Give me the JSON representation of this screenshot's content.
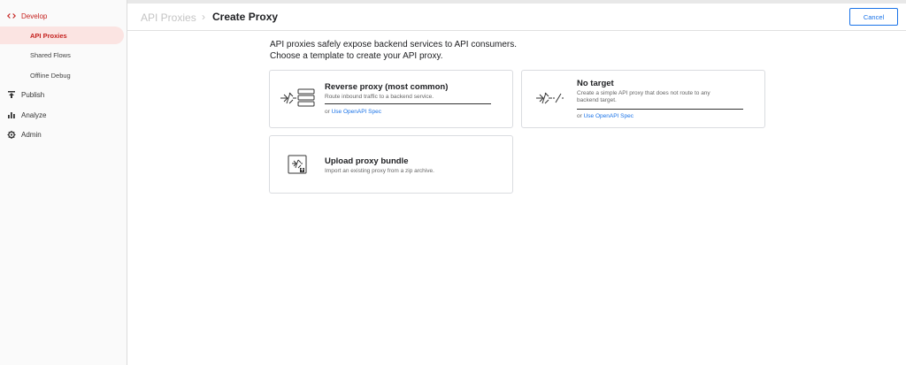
{
  "sidebar": {
    "develop": "Develop",
    "items": [
      "API Proxies",
      "Shared Flows",
      "Offline Debug"
    ],
    "publish": "Publish",
    "analyze": "Analyze",
    "admin": "Admin"
  },
  "header": {
    "crumb_parent": "API Proxies",
    "crumb_sep": "›",
    "title": "Create Proxy",
    "cancel": "Cancel"
  },
  "intro": {
    "line1": "API proxies safely expose backend services to API consumers.",
    "line2": "Choose a template to create your API proxy."
  },
  "cards": {
    "reverse": {
      "title": "Reverse proxy (most common)",
      "desc": "Route inbound traffic to a backend service.",
      "spec_prefix": "or ",
      "spec_link": "Use OpenAPI Spec"
    },
    "notarget": {
      "title": "No target",
      "desc1": "Create a simple API proxy that does not route to any",
      "desc2": "backend target.",
      "spec_prefix": "or ",
      "spec_link": "Use OpenAPI Spec"
    },
    "upload": {
      "title": "Upload proxy bundle",
      "desc": "Import an existing proxy from a zip archive."
    }
  },
  "colors": {
    "accent": "#1a73e8",
    "active": "#c5221f",
    "active_bg": "#fbe4e2"
  }
}
